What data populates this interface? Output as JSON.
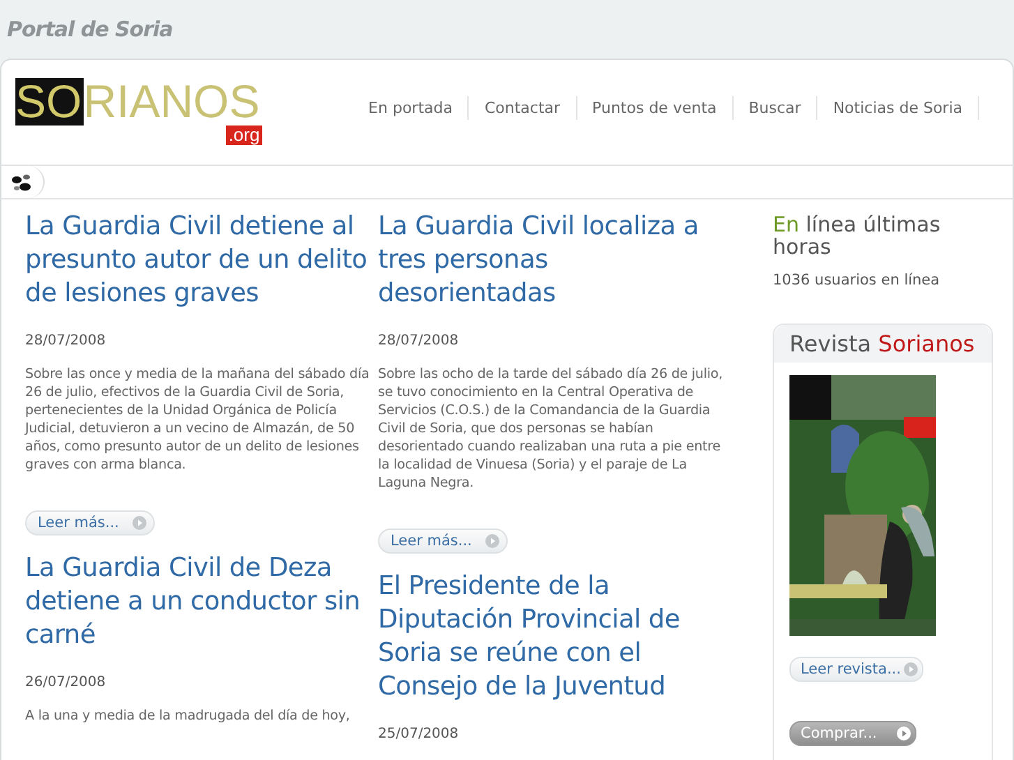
{
  "site_title": "Portal de Soria",
  "logo": {
    "dark_part": "SO",
    "light_part": "RIANOS",
    "suffix": ".org"
  },
  "nav": [
    {
      "label": "En portada"
    },
    {
      "label": "Contactar"
    },
    {
      "label": "Puntos de venta"
    },
    {
      "label": "Buscar"
    },
    {
      "label": "Noticias de Soria"
    }
  ],
  "columns": [
    [
      {
        "title": "La Guardia Civil detiene al presunto autor de un delito de lesiones graves",
        "date": "28/07/2008",
        "body": "Sobre las once y media de la mañana del sábado día 26 de julio, efectivos de la Guardia Civil de Soria, pertenecientes de la Unidad Orgánica de Policía Judicial, detuvieron a un vecino de Almazán, de 50 años, como presunto autor de un delito de lesiones graves con arma blanca.",
        "read_more": "Leer más..."
      },
      {
        "title": "La Guardia Civil de Deza detiene a un conductor sin carné",
        "date": "26/07/2008",
        "body": "A la una y media de la madrugada del día de hoy,"
      }
    ],
    [
      {
        "title": "La Guardia Civil localiza a tres personas desorientadas",
        "date": "28/07/2008",
        "body": "Sobre las ocho de la tarde del sábado día 26 de julio, se tuvo conocimiento en la Central Operativa de Servicios (C.O.S.) de la Comandancia de la Guardia Civil de Soria, que dos personas se habían desorientado cuando realizaban una ruta a pie entre la localidad de Vinuesa (Soria) y el paraje de La Laguna Negra.",
        "read_more": "Leer más..."
      },
      {
        "title": "El Presidente de la Diputación Provincial de Soria se reúne con el Consejo de la Juventud",
        "date": "25/07/2008"
      }
    ]
  ],
  "sidebar": {
    "online_title_accent": "En",
    "online_title": "línea últimas horas",
    "online_count": "1036 usuarios en línea",
    "magazine": {
      "title": "Revista",
      "title_accent": "Sorianos",
      "read_button": "Leer revista...",
      "buy_button": "Comprar..."
    }
  }
}
